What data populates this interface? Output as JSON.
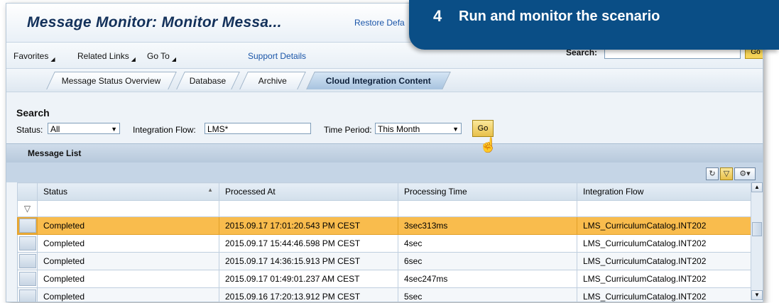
{
  "window": {
    "title": "Message Monitor: Monitor Messa...",
    "restore_label": "Restore Defa"
  },
  "callout": {
    "number": "4",
    "text": "Run and monitor the scenario"
  },
  "menubar": {
    "items": [
      "Favorites",
      "Related Links",
      "Go To"
    ],
    "support_details": "Support Details",
    "search_label": "Search:",
    "search_value": "",
    "search_go": "Go"
  },
  "tabs": [
    {
      "label": "Message Status Overview",
      "active": false
    },
    {
      "label": "Database",
      "active": false
    },
    {
      "label": "Archive",
      "active": false
    },
    {
      "label": "Cloud Integration Content",
      "active": true
    }
  ],
  "search": {
    "heading": "Search",
    "status_label": "Status:",
    "status_value": "All",
    "integration_flow_label": "Integration Flow:",
    "integration_flow_value": "LMS*",
    "time_period_label": "Time Period:",
    "time_period_value": "This Month",
    "go_label": "Go"
  },
  "message_list": {
    "title": "Message List",
    "columns": [
      "Status",
      "Processed At",
      "Processing Time",
      "Integration Flow"
    ],
    "rows": [
      {
        "status": "Completed",
        "processed_at": "2015.09.17 17:01:20.543 PM CEST",
        "processing_time": "3sec313ms",
        "integration_flow": "LMS_CurriculumCatalog.INT202",
        "selected": true
      },
      {
        "status": "Completed",
        "processed_at": "2015.09.17 15:44:46.598 PM CEST",
        "processing_time": "4sec",
        "integration_flow": "LMS_CurriculumCatalog.INT202",
        "selected": false
      },
      {
        "status": "Completed",
        "processed_at": "2015.09.17 14:36:15.913 PM CEST",
        "processing_time": "6sec",
        "integration_flow": "LMS_CurriculumCatalog.INT202",
        "selected": false
      },
      {
        "status": "Completed",
        "processed_at": "2015.09.17 01:49:01.237 AM CEST",
        "processing_time": "4sec247ms",
        "integration_flow": "LMS_CurriculumCatalog.INT202",
        "selected": false
      },
      {
        "status": "Completed",
        "processed_at": "2015.09.16 17:20:13.912 PM CEST",
        "processing_time": "5sec",
        "integration_flow": "LMS_CurriculumCatalog.INT202",
        "selected": false
      }
    ]
  },
  "colors": {
    "callout_bg": "#0a4e86",
    "highlight_row": "#f9bc4d",
    "title_text": "#12305a",
    "link": "#1a55a8"
  }
}
